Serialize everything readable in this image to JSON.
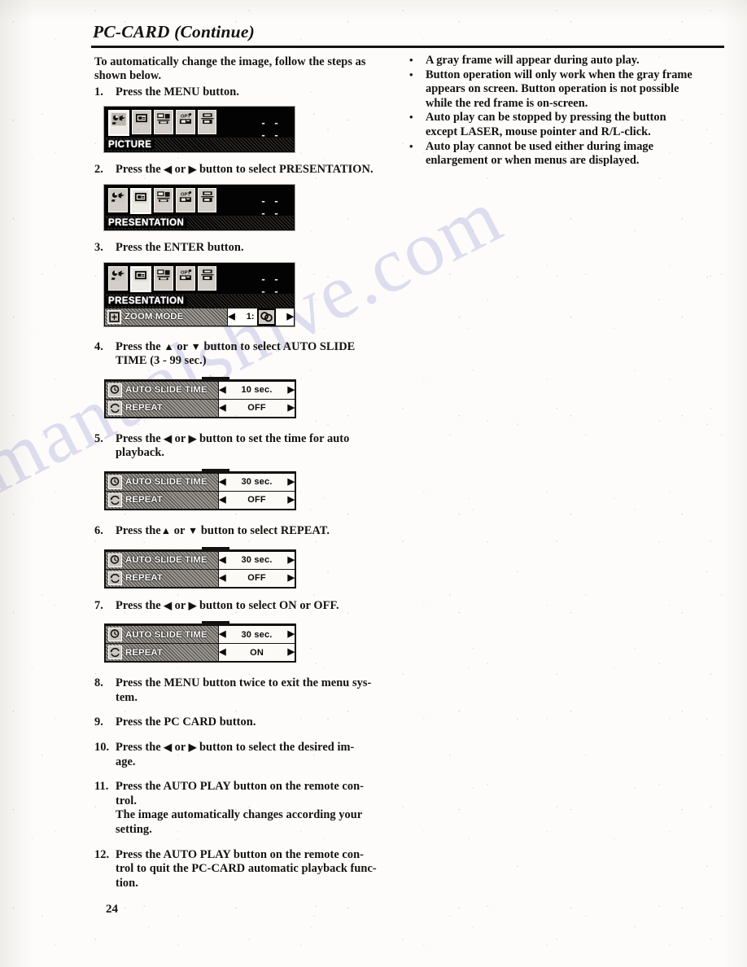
{
  "header": {
    "title": "PC-CARD (Continue)"
  },
  "intro": "To automatically change the image, follow the steps as shown below.",
  "steps": [
    {
      "num": "1.",
      "text": "Press the MENU button."
    },
    {
      "num": "2.",
      "pre": "Press the ",
      "arrow1": "◀",
      "mid": " or ",
      "arrow2": "▶",
      "post": " button to select PRESENTATION."
    },
    {
      "num": "3.",
      "text": "Press the ENTER button."
    },
    {
      "num": "4.",
      "pre": "Press the ",
      "arrow1": "▲",
      "mid": " or ",
      "arrow2": "▼",
      "post": " button to select AUTO SLIDE",
      "sub": "TIME (3 - 99 sec.)"
    },
    {
      "num": "5.",
      "pre": "Press the ",
      "arrow1": "◀",
      "mid": " or ",
      "arrow2": "▶",
      "post": " button to set the time for auto",
      "sub": "playback."
    },
    {
      "num": "6.",
      "pre": "Press the",
      "arrow1": "▲",
      "mid": " or ",
      "arrow2": "▼",
      "post": " button to select REPEAT."
    },
    {
      "num": "7.",
      "pre": "Press the ",
      "arrow1": "◀",
      "mid": " or ",
      "arrow2": "▶",
      "post": " button to select ON or OFF."
    },
    {
      "num": "8.",
      "text": "Press the MENU button twice to exit the menu sys-",
      "sub": "tem."
    },
    {
      "num": "9.",
      "text": "Press the PC CARD button."
    },
    {
      "num": "10.",
      "pre": "Press the ",
      "arrow1": "◀",
      "mid": " or ",
      "arrow2": "▶",
      "post": " button to select the desired im-",
      "sub": "age."
    },
    {
      "num": "11.",
      "text": "Press the AUTO PLAY button on the remote con-",
      "sub": "trol.",
      "sub2": "The image automatically changes according your",
      "sub3": "setting."
    },
    {
      "num": "12.",
      "text": "Press the AUTO PLAY button on the remote con-",
      "sub": "trol to quit the PC-CARD automatic playback func-",
      "sub2": "tion."
    }
  ],
  "osd": {
    "dashes": "- - - -",
    "menu_picture": {
      "label": "PICTURE",
      "selected_index": 0,
      "icons": [
        "picture-icon",
        "presentation-icon",
        "signal-icon",
        "option-icon",
        "setup-icon"
      ]
    },
    "menu_presentation": {
      "label": "PRESENTATION",
      "selected_index": 1,
      "icons": [
        "picture-icon",
        "presentation-icon",
        "signal-icon",
        "option-icon",
        "setup-icon"
      ]
    },
    "menu_presentation_zoom": {
      "label": "PRESENTATION",
      "selected_index": 1,
      "icons": [
        "picture-icon",
        "presentation-icon",
        "signal-icon",
        "option-icon",
        "setup-icon"
      ],
      "row": {
        "label": "ZOOM MODE",
        "left_arrow": "◀",
        "value": "1:",
        "right_arrow": "▶"
      }
    },
    "panels": [
      {
        "name": "panel-step4",
        "rows": [
          {
            "label": "AUTO SLIDE TIME",
            "left_arrow": "◀",
            "value": "10 sec.",
            "right_arrow": "▶",
            "highlighted": true
          },
          {
            "label": "REPEAT",
            "left_arrow": "◀",
            "value": "OFF",
            "right_arrow": "▶",
            "highlighted": false
          }
        ]
      },
      {
        "name": "panel-step5",
        "rows": [
          {
            "label": "AUTO SLIDE TIME",
            "left_arrow": "◀",
            "value": "30 sec.",
            "right_arrow": "▶",
            "highlighted": true
          },
          {
            "label": "REPEAT",
            "left_arrow": "◀",
            "value": "OFF",
            "right_arrow": "▶",
            "highlighted": false
          }
        ]
      },
      {
        "name": "panel-step6",
        "rows": [
          {
            "label": "AUTO SLIDE TIME",
            "left_arrow": "◀",
            "value": "30 sec.",
            "right_arrow": "▶",
            "highlighted": false
          },
          {
            "label": "REPEAT",
            "left_arrow": "◀",
            "value": "OFF",
            "right_arrow": "▶",
            "highlighted": true
          }
        ]
      },
      {
        "name": "panel-step7",
        "rows": [
          {
            "label": "AUTO SLIDE TIME",
            "left_arrow": "◀",
            "value": "30 sec.",
            "right_arrow": "▶",
            "highlighted": false
          },
          {
            "label": "REPEAT",
            "left_arrow": "◀",
            "value": "ON",
            "right_arrow": "▶",
            "highlighted": true
          }
        ]
      }
    ]
  },
  "notes": [
    "A gray frame will appear during auto play.",
    "Button operation will only work when the gray frame appears on screen. Button operation is not possible while the red frame is on-screen.",
    "Auto play can be stopped by pressing the button except LASER, mouse pointer and R/L-click.",
    "Auto play cannot be used either during image enlargement or when menus are displayed."
  ],
  "bullet_glyph": "•",
  "page_number": "24",
  "watermark": "manualshive.com"
}
